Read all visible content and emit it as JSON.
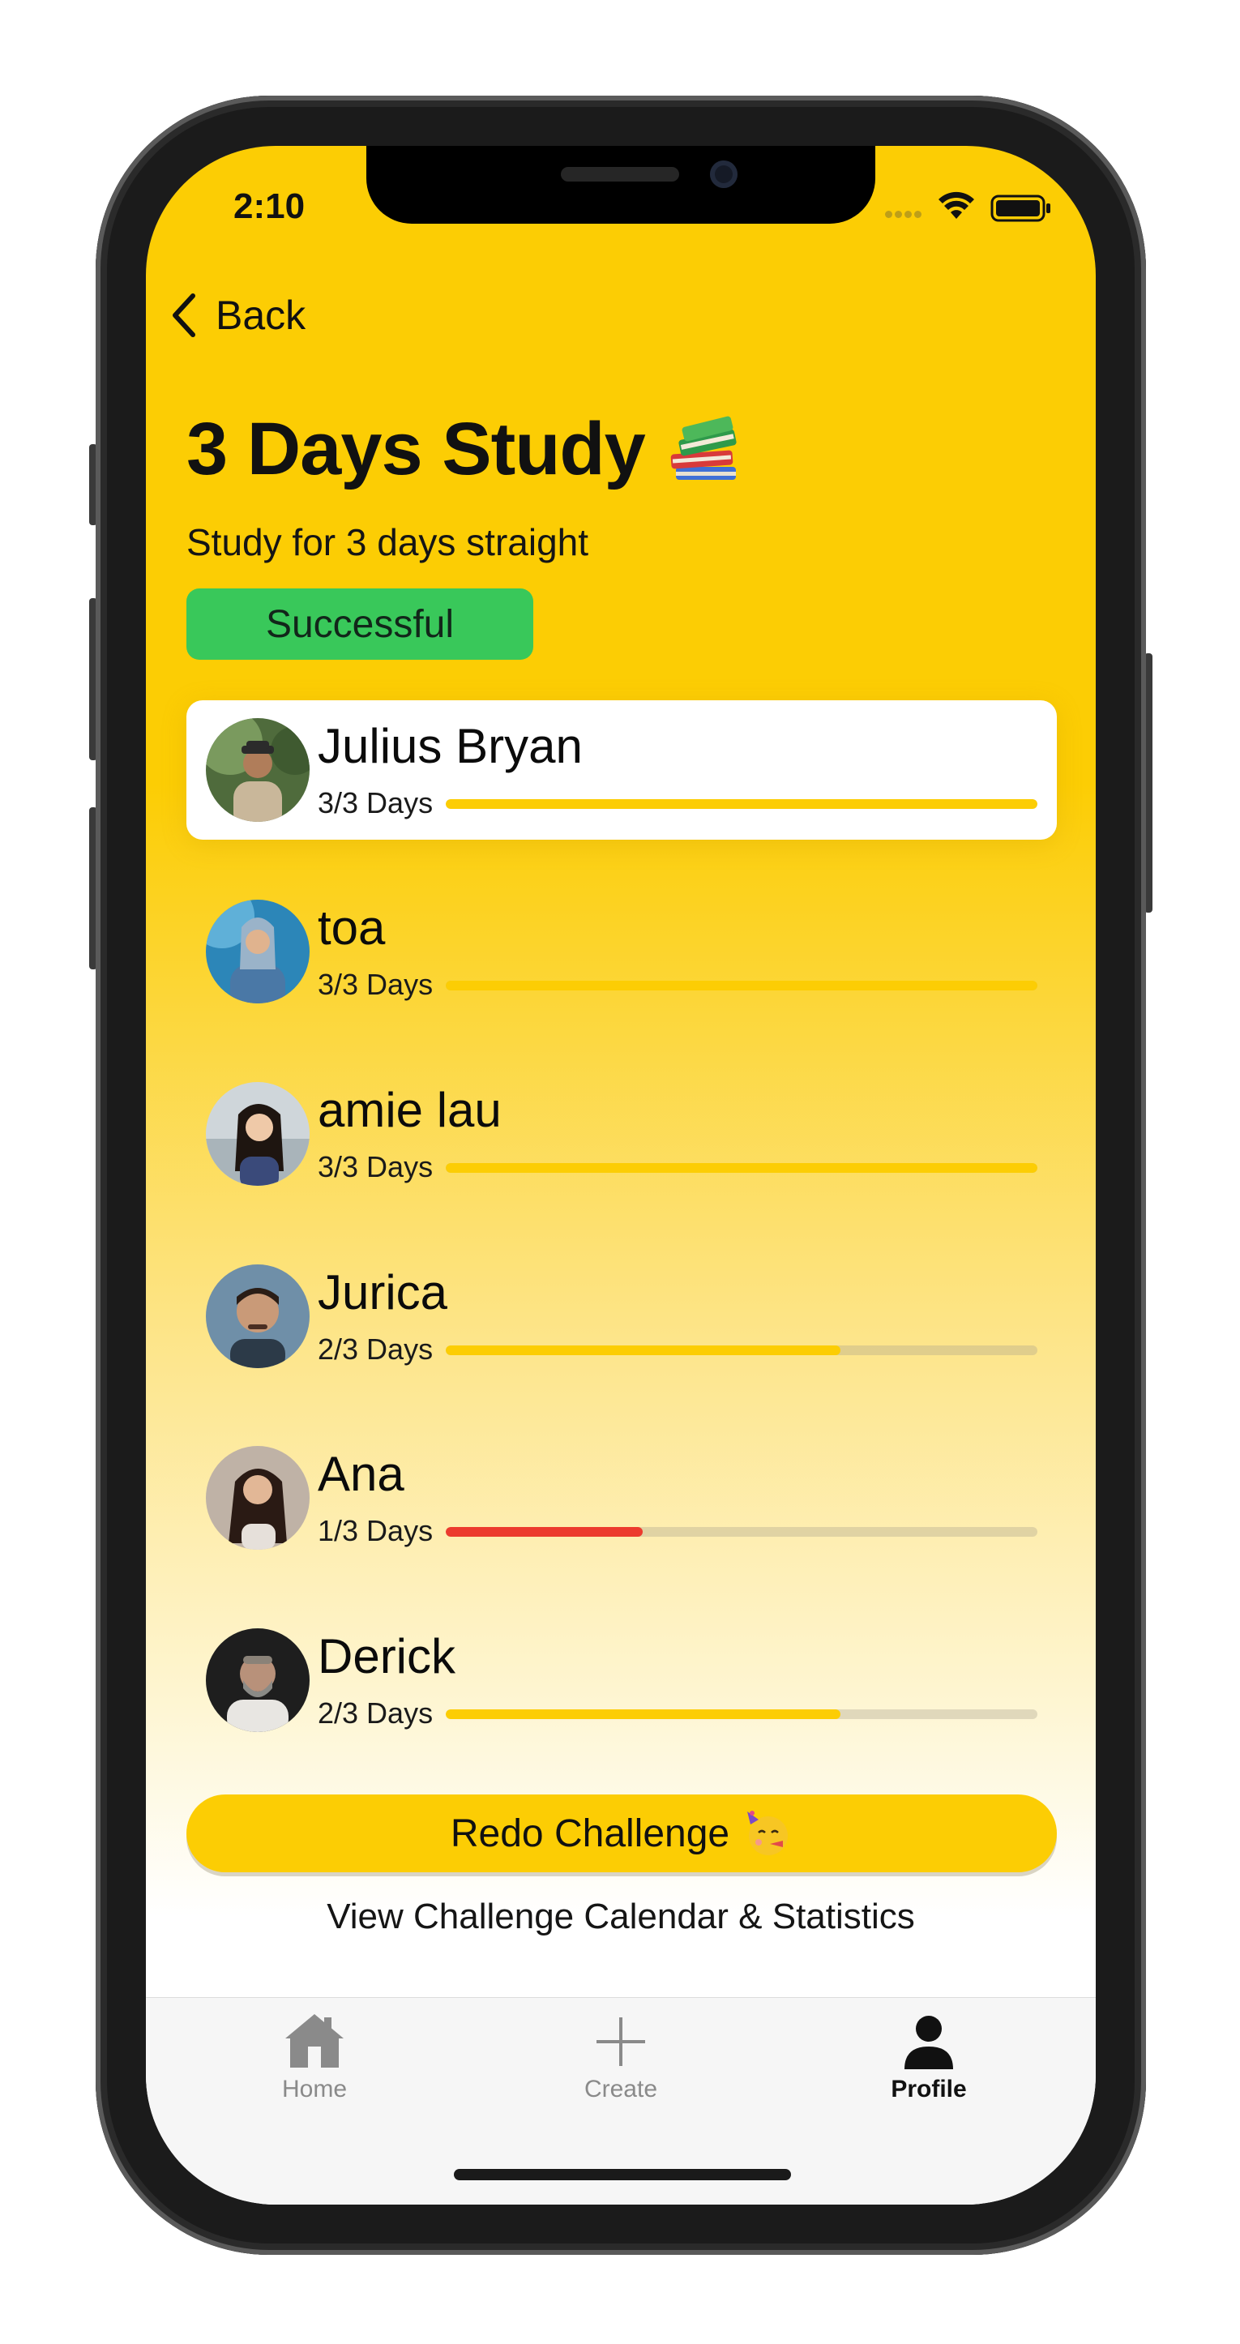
{
  "status_bar": {
    "time": "2:10"
  },
  "nav": {
    "back_label": "Back"
  },
  "challenge": {
    "title": "3 Days Study",
    "title_icon": "books-icon",
    "subtitle": "Study for 3 days straight",
    "status": "Successful"
  },
  "participants": [
    {
      "name": "Julius Bryan",
      "progress_text": "3/3 Days",
      "progress": 1.0,
      "bar_color": "#fccd04",
      "highlighted": true
    },
    {
      "name": "toa",
      "progress_text": "3/3 Days",
      "progress": 1.0,
      "bar_color": "#fccd04",
      "highlighted": false
    },
    {
      "name": "amie lau",
      "progress_text": "3/3 Days",
      "progress": 1.0,
      "bar_color": "#fccd04",
      "highlighted": false
    },
    {
      "name": "Jurica",
      "progress_text": "2/3 Days",
      "progress": 0.667,
      "bar_color": "#fccd04",
      "highlighted": false
    },
    {
      "name": "Ana",
      "progress_text": "1/3 Days",
      "progress": 0.333,
      "bar_color": "#ec3b2e",
      "highlighted": false
    },
    {
      "name": "Derick",
      "progress_text": "2/3 Days",
      "progress": 0.667,
      "bar_color": "#fccd04",
      "highlighted": false
    }
  ],
  "actions": {
    "redo_label": "Redo Challenge",
    "redo_icon": "party-face-icon",
    "calendar_link": "View Challenge Calendar & Statistics"
  },
  "tabs": [
    {
      "label": "Home",
      "icon": "home-icon",
      "active": false
    },
    {
      "label": "Create",
      "icon": "plus-icon",
      "active": false
    },
    {
      "label": "Profile",
      "icon": "person-icon",
      "active": true
    }
  ],
  "colors": {
    "accent": "#fccd04",
    "success": "#39c85a",
    "danger": "#ec3b2e"
  }
}
